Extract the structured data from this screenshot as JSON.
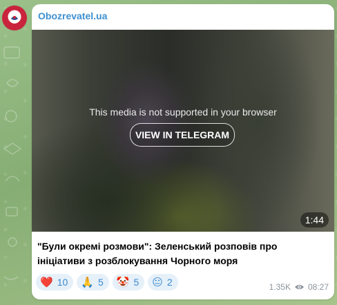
{
  "channel": {
    "name": "Obozrevatel.ua",
    "avatar_icon": "obozrevatel-logo-icon"
  },
  "media": {
    "message": "This media is not supported in your browser",
    "button_label": "VIEW IN TELEGRAM",
    "duration": "1:44"
  },
  "post": {
    "caption": "\"Були окремі розмови\": Зеленський розповів про ініціативи з розблокування Чорного моря"
  },
  "reactions": [
    {
      "emoji": "❤️",
      "icon": "heart-icon",
      "count": "10"
    },
    {
      "emoji": "🙏",
      "icon": "pray-icon",
      "count": "5"
    },
    {
      "emoji": "🤡",
      "icon": "clown-icon",
      "count": "5"
    },
    {
      "emoji": "😐",
      "icon": "neutral-face-icon",
      "count": "2"
    }
  ],
  "meta": {
    "views": "1.35K",
    "view_icon": "eye-icon",
    "time": "08:27"
  },
  "colors": {
    "accent": "#3d8fd0",
    "reaction_bg": "#e6f0f9",
    "chat_bg": "#8fb47a"
  }
}
